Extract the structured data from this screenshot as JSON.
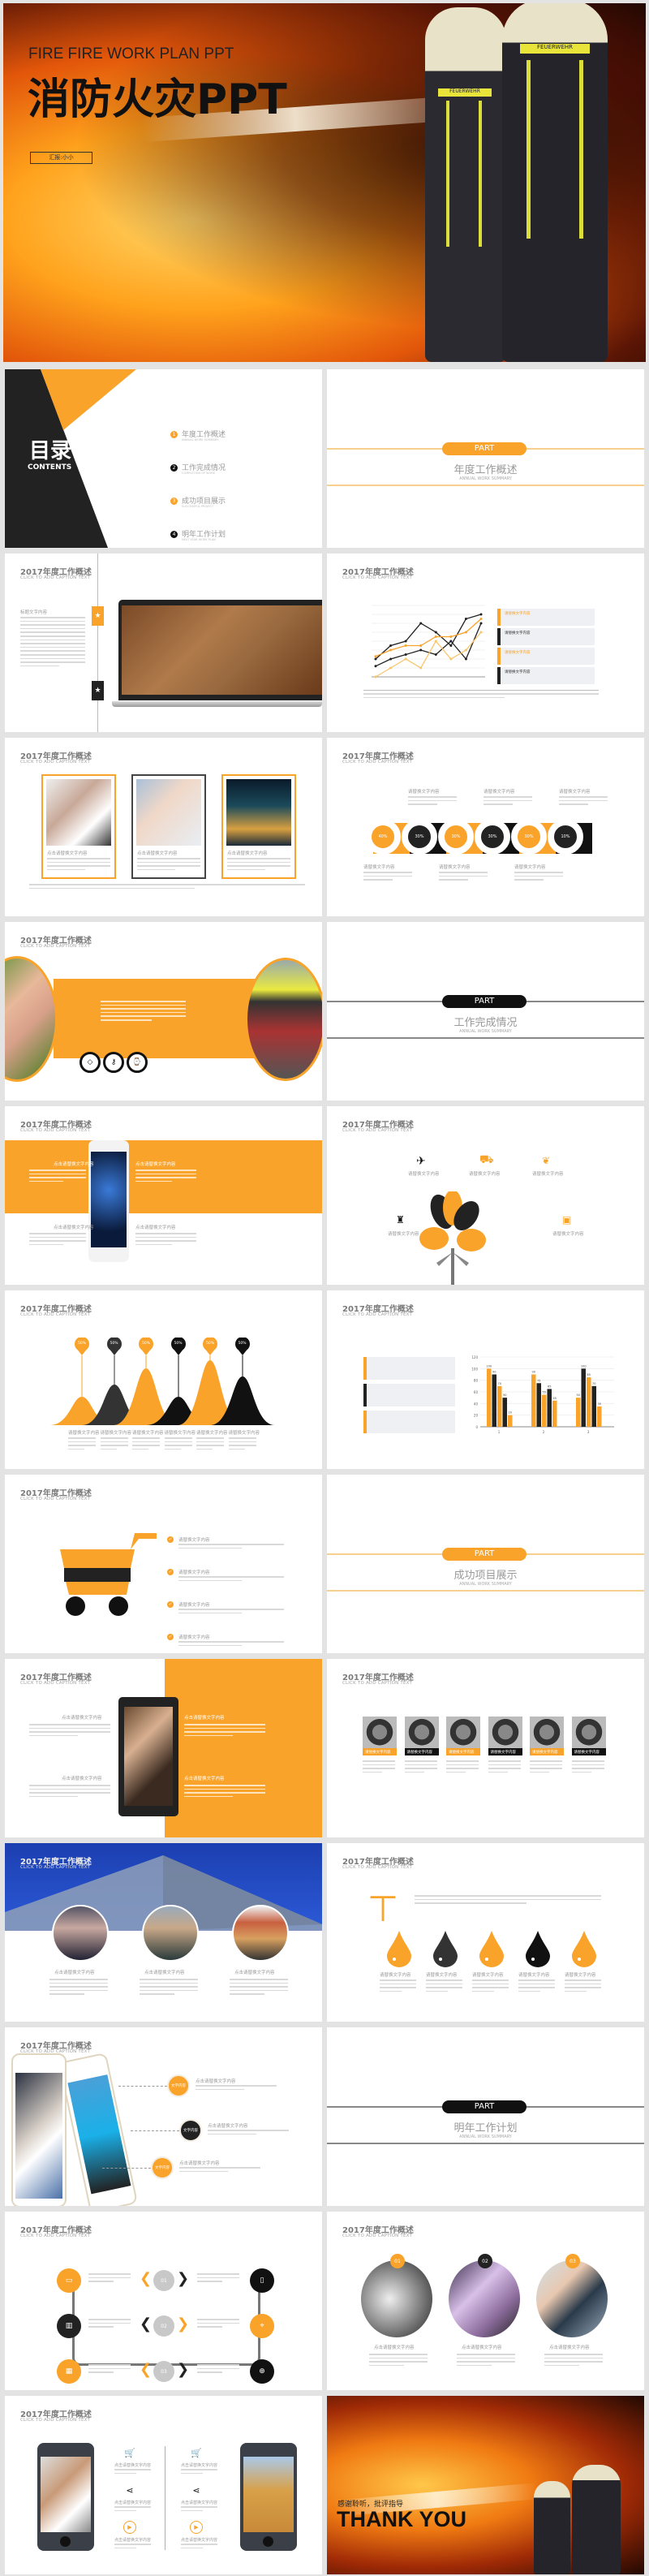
{
  "hero": {
    "subtitle": "FIRE FIRE WORK PLAN PPT",
    "title": "消防火灾PPT",
    "reporter": "汇报:小小",
    "badge_text": "FEUERWEHR"
  },
  "header": {
    "title": "2017年度工作概述",
    "caption": "CLICK TO ADD CAPTION TEXT"
  },
  "contents": {
    "title": "目录",
    "subtitle": "CONTENTS",
    "items": [
      {
        "num": "1",
        "label": "年度工作概述",
        "sub": "ANNUAL WORK SUMMARY"
      },
      {
        "num": "2",
        "label": "工作完成情况",
        "sub": "COMPLETION OF WORK"
      },
      {
        "num": "3",
        "label": "成功项目展示",
        "sub": "SUCCESSFUL PROJECT"
      },
      {
        "num": "4",
        "label": "明年工作计划",
        "sub": "NEXT YEAR WORK PLAN"
      }
    ]
  },
  "parts": [
    {
      "pill": "PART",
      "title": "年度工作概述",
      "sub": "ANNUAL WORK SUMMARY",
      "style": "orange"
    },
    {
      "pill": "PART",
      "title": "工作完成情况",
      "sub": "ANNUAL WORK SUMMARY",
      "style": "black"
    },
    {
      "pill": "PART",
      "title": "成功项目展示",
      "sub": "ANNUAL WORK SUMMARY",
      "style": "orange"
    },
    {
      "pill": "PART",
      "title": "明年工作计划",
      "sub": "ANNUAL WORK SUMMARY",
      "style": "black"
    }
  ],
  "text": {
    "replace": "请替换文字内容",
    "click_replace": "点击请替换文字内容",
    "content": "文字内容",
    "title_label": "标题文字内容",
    "short": "请替换文字内容"
  },
  "circles": {
    "percents": [
      "40%",
      "30%",
      "30%",
      "30%",
      "30%",
      "10%"
    ],
    "label": "Ser..."
  },
  "bells": {
    "percents": [
      "50%",
      "50%",
      "50%",
      "50%",
      "50%",
      "50%"
    ]
  },
  "numbers": [
    "01",
    "02",
    "03"
  ],
  "thanks": {
    "cn": "感谢聆听，批评指导",
    "en": "THANK YOU"
  },
  "colors": {
    "accent": "#f9a32a",
    "dark": "#222222",
    "bg": "#e3e3e3"
  },
  "chart_data": [
    {
      "type": "line",
      "x": [
        1,
        2,
        3,
        4,
        5,
        6,
        7,
        8
      ],
      "ylim": [
        0,
        8
      ],
      "grid": true,
      "series": [
        {
          "color": "#222222",
          "values": [
            2,
            3.5,
            4,
            6,
            5,
            3.5,
            6.5,
            7
          ]
        },
        {
          "color": "#222222",
          "values": [
            1.2,
            2,
            2.5,
            3,
            2.5,
            4,
            2,
            6
          ]
        },
        {
          "color": "#f9a32a",
          "values": [
            2.3,
            3,
            3.5,
            3.5,
            4.5,
            4.5,
            5,
            6.5
          ]
        },
        {
          "color": "#f9c56a",
          "values": [
            0,
            1,
            2,
            1,
            4,
            2,
            3,
            5
          ]
        }
      ]
    },
    {
      "type": "bar",
      "categories": [
        "1",
        "2",
        "3"
      ],
      "ylim": [
        0,
        120
      ],
      "yticks": [
        0,
        20,
        40,
        60,
        80,
        100,
        120
      ],
      "grid": true,
      "series": [
        {
          "color": "#f9a32a",
          "values": [
            100,
            90,
            50
          ]
        },
        {
          "color": "#222222",
          "values": [
            90,
            75,
            100
          ]
        },
        {
          "color": "#f9a32a",
          "values": [
            70,
            55,
            85
          ]
        },
        {
          "color": "#222222",
          "values": [
            50,
            65,
            70
          ]
        },
        {
          "color": "#f9a32a",
          "values": [
            20,
            45,
            35
          ]
        }
      ]
    }
  ]
}
